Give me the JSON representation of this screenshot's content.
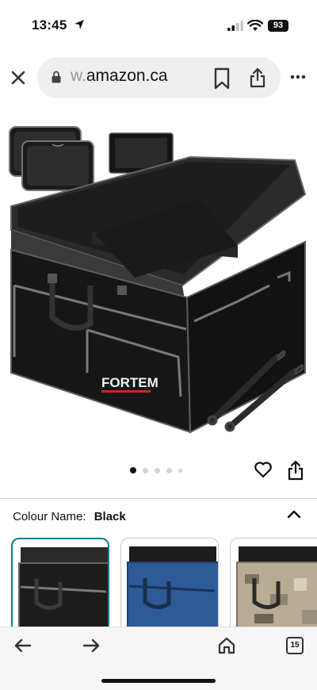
{
  "status_bar": {
    "time": "13:45",
    "battery": "93"
  },
  "browser": {
    "url_prefix": "w.",
    "url_domain": "amazon.ca",
    "icons": [
      "close-icon",
      "lock-icon",
      "bookmark-icon",
      "share-icon",
      "more-icon"
    ]
  },
  "product": {
    "image_brand_text": "FORTEM",
    "carousel": {
      "total": 5,
      "active": 1
    }
  },
  "variation": {
    "label": "Colour Name:",
    "value": "Black",
    "options": [
      "Black",
      "Blue",
      "Camo"
    ],
    "selected_index": 0
  },
  "toolbar": {
    "tab_count": "15"
  },
  "colors": {
    "accent": "#147c8f",
    "brand_red": "#d0202a",
    "body_black": "#1a1a1a",
    "piping_grey": "#7a7a7a"
  }
}
